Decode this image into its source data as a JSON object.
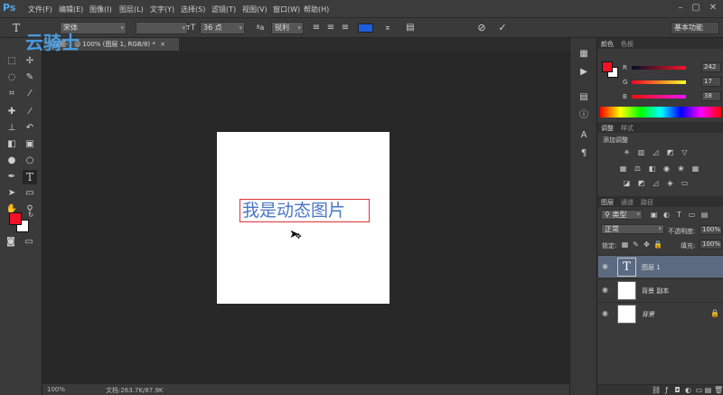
{
  "app": {
    "logo": "Ps"
  },
  "menu": [
    "文件(F)",
    "编辑(E)",
    "图像(I)",
    "图层(L)",
    "文字(Y)",
    "选择(S)",
    "滤镜(T)",
    "视图(V)",
    "窗口(W)",
    "帮助(H)"
  ],
  "window_controls": {
    "minimize": "–",
    "maximize": "▢",
    "close": "✕"
  },
  "options": {
    "font_family": "宋体",
    "font_style": "",
    "font_size": "36 点",
    "antialias": "锐利",
    "text_color": "#1c5ee0",
    "workspace": "基本功能",
    "cancel": "⊘",
    "commit": "✓"
  },
  "document": {
    "tab_title": "未标题-1 @ 100% (图层 1, RGB/8) *",
    "tab_close": "×",
    "text": "我是动态图片",
    "text_color": "#4a76c6",
    "box_color": "#e0323a"
  },
  "watermark": {
    "text": "云骑士"
  },
  "status": {
    "zoom": "100%",
    "doc_size": "文档:263.7K/87.9K"
  },
  "colors": {
    "foreground": "#f21126",
    "background": "#ffffff"
  },
  "color_panel": {
    "tabs": [
      "颜色",
      "色板"
    ],
    "channels": [
      {
        "label": "R",
        "value": "242"
      },
      {
        "label": "G",
        "value": "17"
      },
      {
        "label": "B",
        "value": "38"
      }
    ]
  },
  "adjust_panel": {
    "tabs": [
      "调整",
      "样式"
    ],
    "title": "添加调整"
  },
  "layers_panel": {
    "tabs": [
      "图层",
      "通道",
      "路径"
    ],
    "kind_filter": "类型",
    "blend_mode": "正常",
    "opacity_label": "不透明度:",
    "opacity_value": "100%",
    "lock_label": "锁定:",
    "fill_label": "填充:",
    "fill_value": "100%",
    "layers": [
      {
        "name": "图层 1",
        "type": "text",
        "selected": true,
        "thumb": "T"
      },
      {
        "name": "背景 副本",
        "type": "image",
        "selected": false
      },
      {
        "name": "背景",
        "type": "image",
        "selected": false,
        "locked": true
      }
    ]
  }
}
